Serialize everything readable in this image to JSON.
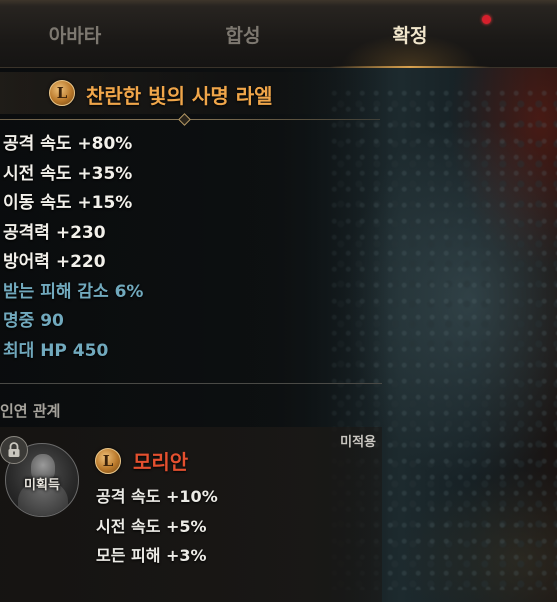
{
  "tabs": [
    {
      "label": "아바타",
      "active": false
    },
    {
      "label": "합성",
      "active": false
    },
    {
      "label": "확정",
      "active": true
    }
  ],
  "notification": {
    "color": "#d61f2c"
  },
  "item": {
    "badge": "L",
    "title": "찬란한 빛의 사명 라엘",
    "title_color": "#f0a64a",
    "stats": [
      {
        "text": "공격 속도 +80%",
        "color": "white"
      },
      {
        "text": "시전 속도 +35%",
        "color": "white"
      },
      {
        "text": "이동 속도 +15%",
        "color": "white"
      },
      {
        "text": "공격력 +230",
        "color": "white"
      },
      {
        "text": "방어력 +220",
        "color": "white"
      },
      {
        "text": "받는 피해 감소 6%",
        "color": "blue"
      },
      {
        "text": "명중 90",
        "color": "blue"
      },
      {
        "text": "최대 HP 450",
        "color": "blue"
      }
    ]
  },
  "bond": {
    "section_label": "인연 관계",
    "status": "미적용",
    "portrait_label": "미획득",
    "lock_icon": "lock-icon",
    "badge": "L",
    "name": "모리안",
    "name_color": "#e4502f",
    "stats": [
      "공격 속도 +10%",
      "시전 속도 +5%",
      "모든 피해 +3%"
    ]
  }
}
